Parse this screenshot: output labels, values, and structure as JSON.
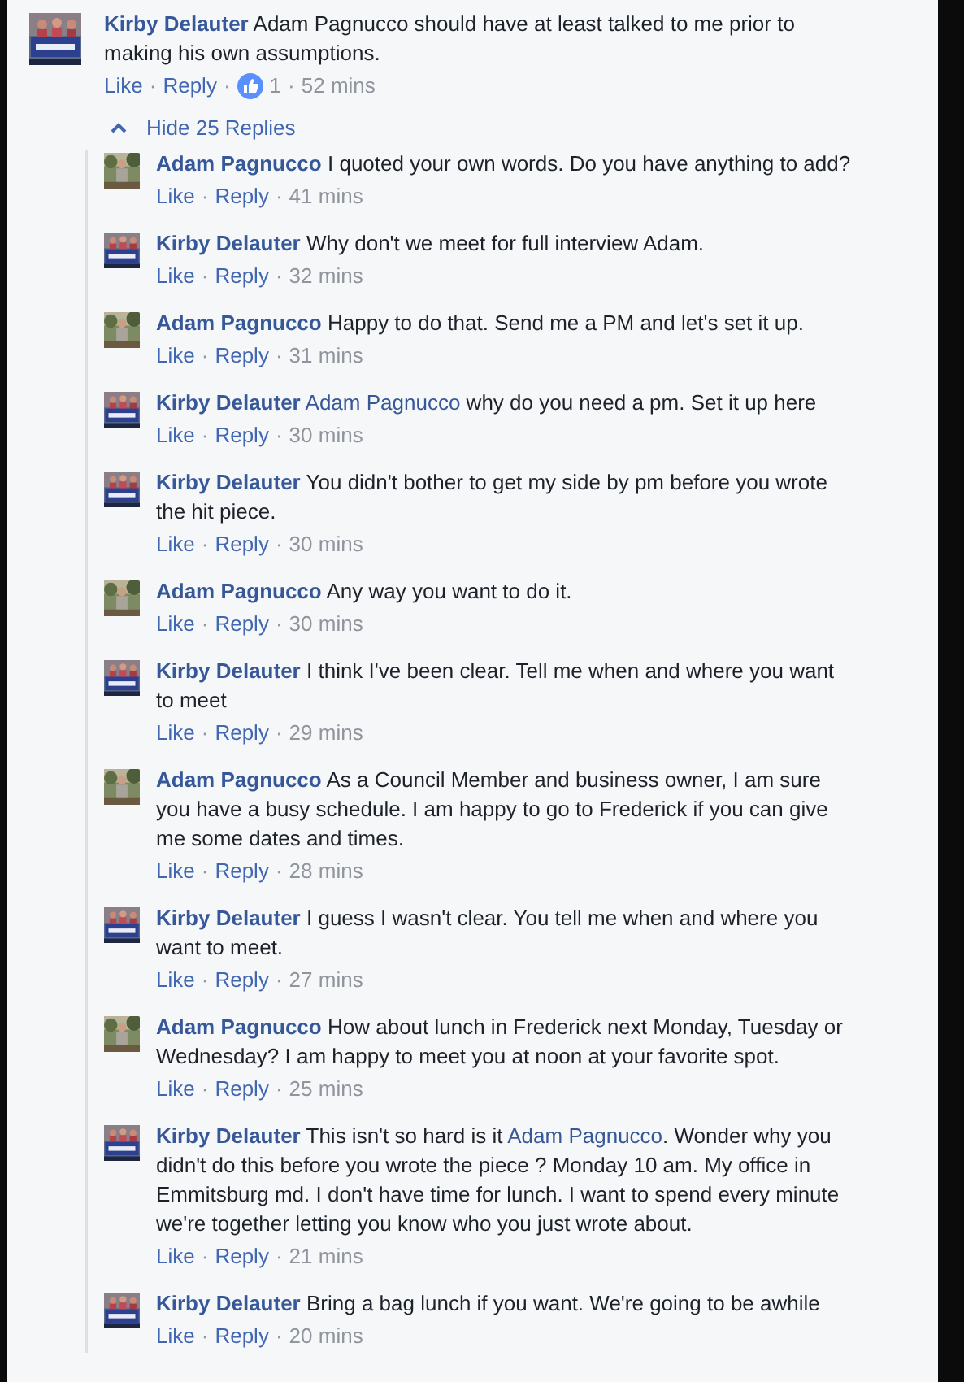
{
  "comment": {
    "avatar": {
      "kind": "banner"
    },
    "author": "Kirby Delauter",
    "body": [
      {
        "kind": "text",
        "text": "Adam Pagnucco should have at least talked to me prior to making his own assumptions."
      }
    ],
    "meta": [
      {
        "kind": "link",
        "text": "Like"
      },
      {
        "kind": "sep",
        "text": "·"
      },
      {
        "kind": "link",
        "text": "Reply"
      },
      {
        "kind": "sep",
        "text": "·"
      },
      {
        "kind": "reactions",
        "text": "1"
      },
      {
        "kind": "sep",
        "text": "·"
      },
      {
        "kind": "time",
        "text": "52 mins"
      }
    ]
  },
  "replies_toggle": {
    "label": "Hide 25 Replies",
    "expanded": true
  },
  "replies": [
    {
      "avatar": {
        "kind": "outdoor"
      },
      "author": "Adam Pagnucco",
      "body": [
        {
          "kind": "text",
          "text": "I quoted your own words. Do you have anything to add?"
        }
      ],
      "meta": [
        {
          "kind": "link",
          "text": "Like"
        },
        {
          "kind": "sep",
          "text": "·"
        },
        {
          "kind": "link",
          "text": "Reply"
        },
        {
          "kind": "sep",
          "text": "·"
        },
        {
          "kind": "time",
          "text": "41 mins"
        }
      ]
    },
    {
      "avatar": {
        "kind": "banner"
      },
      "author": "Kirby Delauter",
      "body": [
        {
          "kind": "text",
          "text": "Why don't we meet for full interview Adam."
        }
      ],
      "meta": [
        {
          "kind": "link",
          "text": "Like"
        },
        {
          "kind": "sep",
          "text": "·"
        },
        {
          "kind": "link",
          "text": "Reply"
        },
        {
          "kind": "sep",
          "text": "·"
        },
        {
          "kind": "time",
          "text": "32 mins"
        }
      ]
    },
    {
      "avatar": {
        "kind": "outdoor"
      },
      "author": "Adam Pagnucco",
      "body": [
        {
          "kind": "text",
          "text": "Happy to do that. Send me a PM and let's set it up."
        }
      ],
      "meta": [
        {
          "kind": "link",
          "text": "Like"
        },
        {
          "kind": "sep",
          "text": "·"
        },
        {
          "kind": "link",
          "text": "Reply"
        },
        {
          "kind": "sep",
          "text": "·"
        },
        {
          "kind": "time",
          "text": "31 mins"
        }
      ]
    },
    {
      "avatar": {
        "kind": "banner"
      },
      "author": "Kirby Delauter",
      "body": [
        {
          "kind": "mention",
          "text": "Adam Pagnucco"
        },
        {
          "kind": "text",
          "text": " why do you need a pm. Set it up here"
        }
      ],
      "meta": [
        {
          "kind": "link",
          "text": "Like"
        },
        {
          "kind": "sep",
          "text": "·"
        },
        {
          "kind": "link",
          "text": "Reply"
        },
        {
          "kind": "sep",
          "text": "·"
        },
        {
          "kind": "time",
          "text": "30 mins"
        }
      ]
    },
    {
      "avatar": {
        "kind": "banner"
      },
      "author": "Kirby Delauter",
      "body": [
        {
          "kind": "text",
          "text": "You didn't bother to get my side by pm before you wrote the hit piece."
        }
      ],
      "meta": [
        {
          "kind": "link",
          "text": "Like"
        },
        {
          "kind": "sep",
          "text": "·"
        },
        {
          "kind": "link",
          "text": "Reply"
        },
        {
          "kind": "sep",
          "text": "·"
        },
        {
          "kind": "time",
          "text": "30 mins"
        }
      ]
    },
    {
      "avatar": {
        "kind": "outdoor"
      },
      "author": "Adam Pagnucco",
      "body": [
        {
          "kind": "text",
          "text": "Any way you want to do it."
        }
      ],
      "meta": [
        {
          "kind": "link",
          "text": "Like"
        },
        {
          "kind": "sep",
          "text": "·"
        },
        {
          "kind": "link",
          "text": "Reply"
        },
        {
          "kind": "sep",
          "text": "·"
        },
        {
          "kind": "time",
          "text": "30 mins"
        }
      ]
    },
    {
      "avatar": {
        "kind": "banner"
      },
      "author": "Kirby Delauter",
      "body": [
        {
          "kind": "text",
          "text": "I think I've been clear. Tell me when and where you want to meet"
        }
      ],
      "meta": [
        {
          "kind": "link",
          "text": "Like"
        },
        {
          "kind": "sep",
          "text": "·"
        },
        {
          "kind": "link",
          "text": "Reply"
        },
        {
          "kind": "sep",
          "text": "·"
        },
        {
          "kind": "time",
          "text": "29 mins"
        }
      ]
    },
    {
      "avatar": {
        "kind": "outdoor"
      },
      "author": "Adam Pagnucco",
      "body": [
        {
          "kind": "text",
          "text": "As a Council Member and business owner, I am sure you have a busy schedule. I am happy to go to Frederick if you can give me some dates and times."
        }
      ],
      "meta": [
        {
          "kind": "link",
          "text": "Like"
        },
        {
          "kind": "sep",
          "text": "·"
        },
        {
          "kind": "link",
          "text": "Reply"
        },
        {
          "kind": "sep",
          "text": "·"
        },
        {
          "kind": "time",
          "text": "28 mins"
        }
      ]
    },
    {
      "avatar": {
        "kind": "banner"
      },
      "author": "Kirby Delauter",
      "body": [
        {
          "kind": "text",
          "text": "I guess I wasn't clear. You tell me when and where you want to meet."
        }
      ],
      "meta": [
        {
          "kind": "link",
          "text": "Like"
        },
        {
          "kind": "sep",
          "text": "·"
        },
        {
          "kind": "link",
          "text": "Reply"
        },
        {
          "kind": "sep",
          "text": "·"
        },
        {
          "kind": "time",
          "text": "27 mins"
        }
      ]
    },
    {
      "avatar": {
        "kind": "outdoor"
      },
      "author": "Adam Pagnucco",
      "body": [
        {
          "kind": "text",
          "text": "How about lunch in Frederick next Monday, Tuesday or Wednesday? I am happy to meet you at noon at your favorite spot."
        }
      ],
      "meta": [
        {
          "kind": "link",
          "text": "Like"
        },
        {
          "kind": "sep",
          "text": "·"
        },
        {
          "kind": "link",
          "text": "Reply"
        },
        {
          "kind": "sep",
          "text": "·"
        },
        {
          "kind": "time",
          "text": "25 mins"
        }
      ]
    },
    {
      "avatar": {
        "kind": "banner"
      },
      "author": "Kirby Delauter",
      "body": [
        {
          "kind": "text",
          "text": "This isn't so hard is it "
        },
        {
          "kind": "mention",
          "text": "Adam Pagnucco"
        },
        {
          "kind": "text",
          "text": ". Wonder why you didn't do this before you wrote the piece ? Monday 10 am. My office in Emmitsburg md. I don't have time for lunch. I want to spend every minute we're together letting you know who you just wrote about."
        }
      ],
      "meta": [
        {
          "kind": "link",
          "text": "Like"
        },
        {
          "kind": "sep",
          "text": "·"
        },
        {
          "kind": "link",
          "text": "Reply"
        },
        {
          "kind": "sep",
          "text": "·"
        },
        {
          "kind": "time",
          "text": "21 mins"
        }
      ]
    },
    {
      "avatar": {
        "kind": "banner"
      },
      "author": "Kirby Delauter",
      "body": [
        {
          "kind": "text",
          "text": "Bring a bag lunch if you want. We're going to be awhile"
        }
      ],
      "meta": [
        {
          "kind": "link",
          "text": "Like"
        },
        {
          "kind": "sep",
          "text": "·"
        },
        {
          "kind": "link",
          "text": "Reply"
        },
        {
          "kind": "sep",
          "text": "·"
        },
        {
          "kind": "time",
          "text": "20 mins"
        }
      ]
    }
  ]
}
